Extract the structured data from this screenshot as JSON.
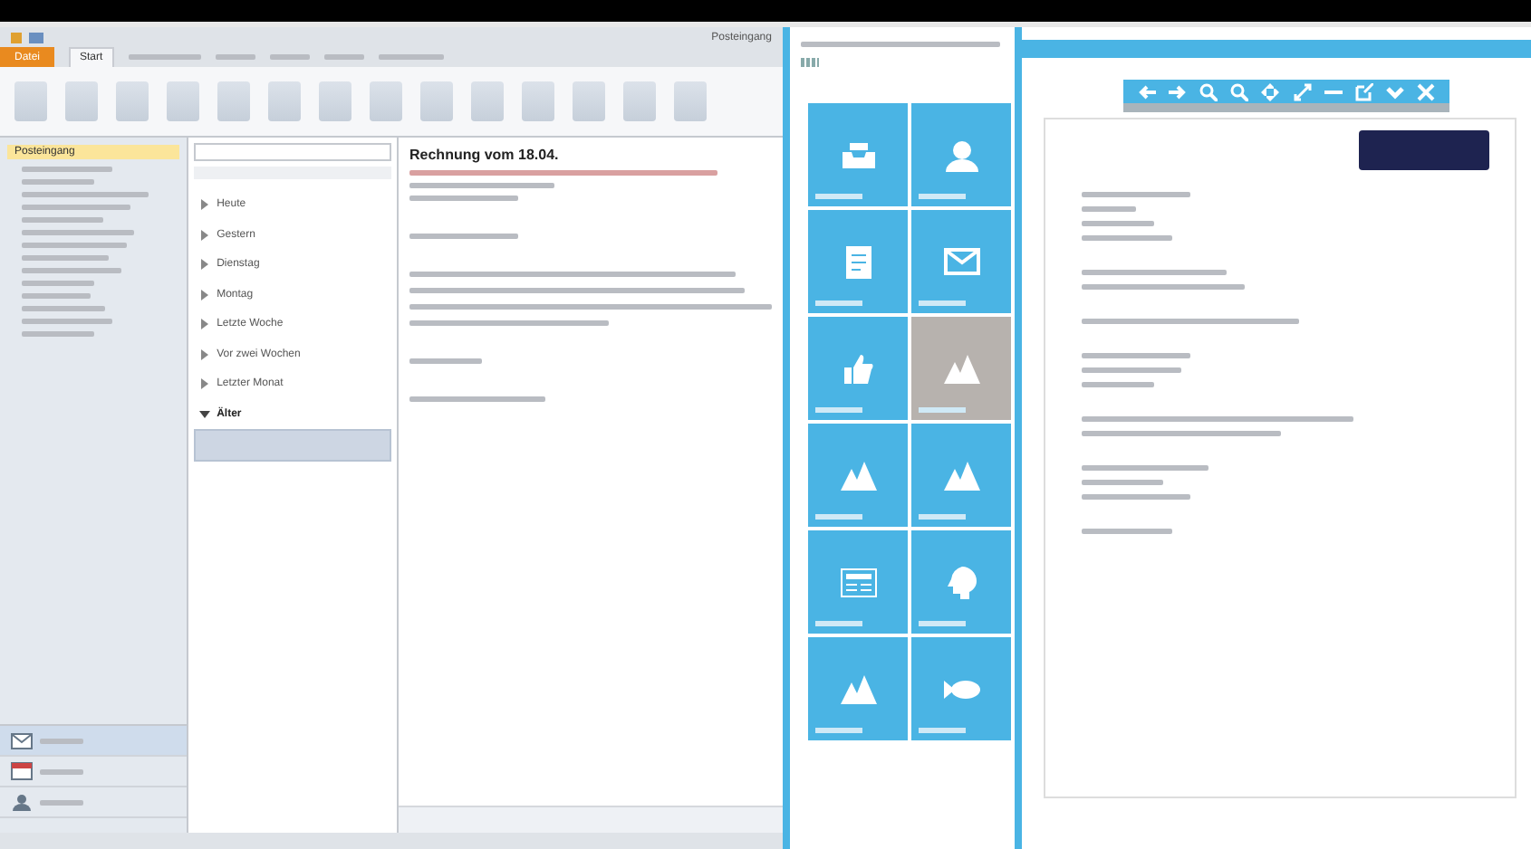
{
  "window": {
    "title": "Posteingang"
  },
  "ribbon": {
    "tabs": [
      {
        "label": "Datei",
        "selected": false,
        "kind": "file"
      },
      {
        "label": "Start",
        "selected": true,
        "kind": "tab"
      }
    ]
  },
  "nav": {
    "folders": [
      {
        "label": "Posteingang",
        "selected": true
      }
    ],
    "buttons": [
      {
        "kind": "mail",
        "selected": true
      },
      {
        "kind": "calendar",
        "selected": false
      },
      {
        "kind": "contacts",
        "selected": false
      }
    ]
  },
  "mail_list": {
    "groups": [
      {
        "label": "Heute",
        "expanded": false
      },
      {
        "label": "Gestern",
        "expanded": false
      },
      {
        "label": "Dienstag",
        "expanded": false
      },
      {
        "label": "Montag",
        "expanded": false
      },
      {
        "label": "Letzte Woche",
        "expanded": false
      },
      {
        "label": "Vor zwei Wochen",
        "expanded": false
      },
      {
        "label": "Letzter Monat",
        "expanded": false
      },
      {
        "label": "Älter",
        "expanded": true
      }
    ]
  },
  "message": {
    "subject": "Rechnung vom 18.04."
  },
  "tiles": [
    {
      "kind": "inbox",
      "selected": false
    },
    {
      "kind": "person",
      "selected": false
    },
    {
      "kind": "document",
      "selected": false
    },
    {
      "kind": "mail",
      "selected": false
    },
    {
      "kind": "thumb",
      "selected": false
    },
    {
      "kind": "mountain",
      "selected": true
    },
    {
      "kind": "mountain",
      "selected": false
    },
    {
      "kind": "mountain",
      "selected": false
    },
    {
      "kind": "news",
      "selected": false
    },
    {
      "kind": "head",
      "selected": false
    },
    {
      "kind": "mountain",
      "selected": false
    },
    {
      "kind": "fish",
      "selected": false
    }
  ],
  "viewer": {
    "tools": [
      {
        "kind": "prev"
      },
      {
        "kind": "next"
      },
      {
        "kind": "zoomin"
      },
      {
        "kind": "zoomout"
      },
      {
        "kind": "move"
      },
      {
        "kind": "expand"
      },
      {
        "kind": "width"
      },
      {
        "kind": "external"
      },
      {
        "kind": "check"
      },
      {
        "kind": "close"
      }
    ]
  }
}
